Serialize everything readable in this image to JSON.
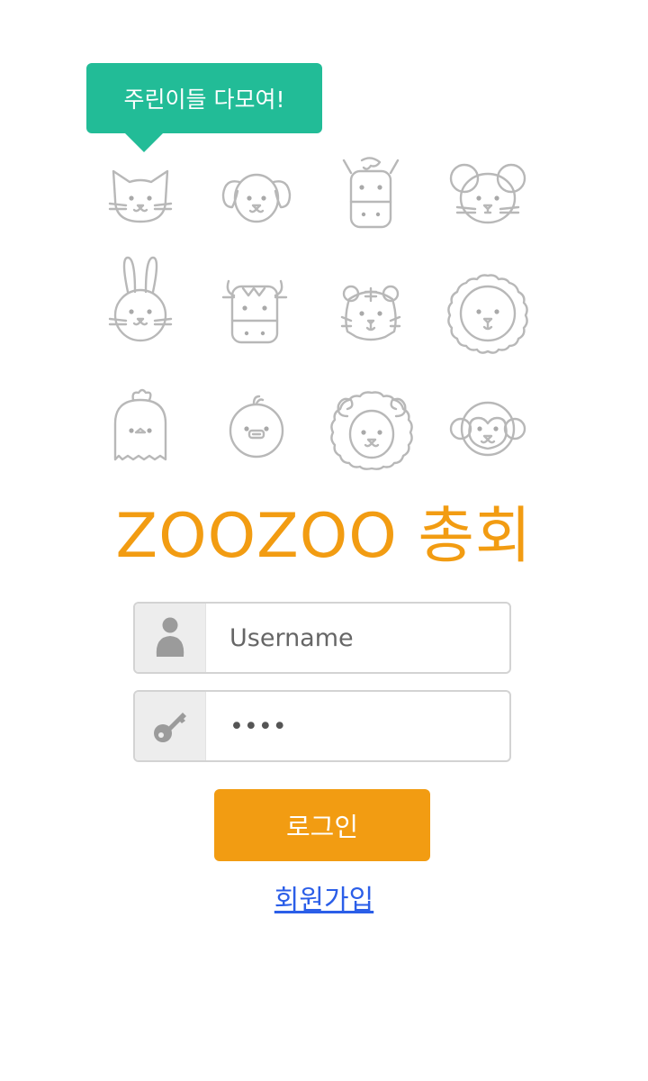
{
  "tooltip": {
    "text": "주린이들 다모여!"
  },
  "animals": [
    "cat",
    "dog",
    "horse",
    "mouse",
    "rabbit",
    "cow",
    "tiger",
    "lion",
    "chicken",
    "chick",
    "sheep",
    "monkey"
  ],
  "title": "ZOOZOO 총회",
  "username": {
    "placeholder": "Username",
    "value": "",
    "icon": "user-icon"
  },
  "password": {
    "value": "test",
    "icon": "key-icon"
  },
  "login_button": {
    "label": "로그인"
  },
  "signup_link": {
    "label": "회원가입"
  },
  "colors": {
    "tooltip": "#22bc97",
    "accent": "#f29c12",
    "link": "#2b5ee8",
    "icon_stroke": "#b8b8b8"
  }
}
